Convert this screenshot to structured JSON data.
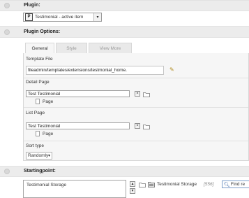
{
  "plugin": {
    "heading": "Plugin:",
    "selected_value": "Testimonial - active item"
  },
  "plugin_options": {
    "heading": "Plugin Options:",
    "tabs": [
      {
        "label": "General"
      },
      {
        "label": "Style"
      },
      {
        "label": "View More"
      }
    ],
    "template_file": {
      "label": "Template File",
      "value": "fileadmin/templates/extensions/testmonial_home."
    },
    "detail_page": {
      "label": "Detail Page",
      "value": "Test Testimonial",
      "item_label": "Page"
    },
    "list_page": {
      "label": "List Page",
      "value": "Test Testimonial",
      "item_label": "Page"
    },
    "sort_type": {
      "label": "Sort type",
      "value": "Randomly"
    }
  },
  "startingpoint": {
    "heading": "Startingpoint:",
    "list_item": "Testimonial Storage",
    "record_label": "Testimonial Storage",
    "record_id": "[556]",
    "find_placeholder": "Find re"
  }
}
